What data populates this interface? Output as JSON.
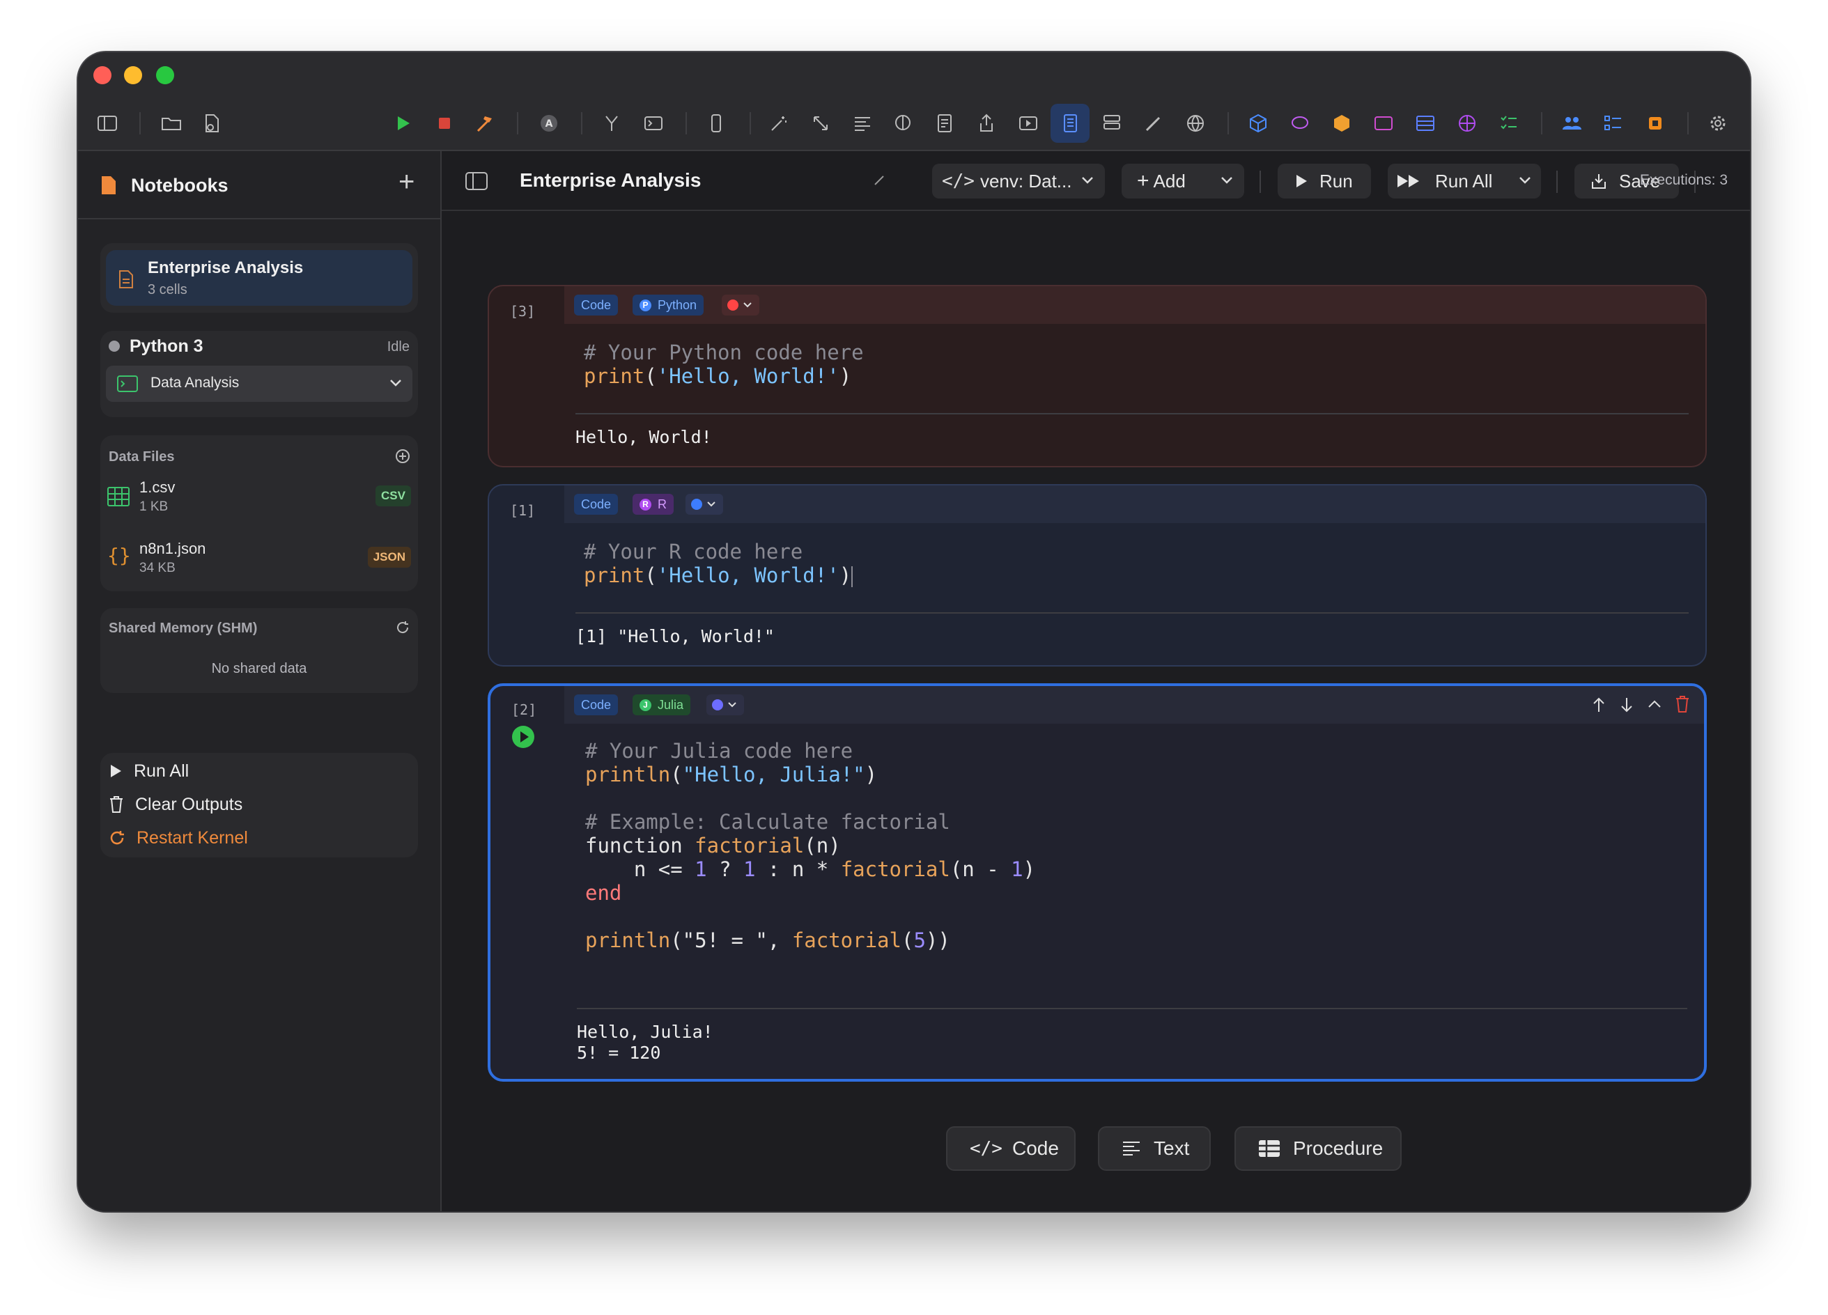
{
  "window": {
    "toolbar": {
      "icons": [
        "sidebar-toggle-icon",
        "folder-icon",
        "document-gear-icon",
        "play-icon",
        "stop-icon",
        "hammer-icon",
        "account-icon",
        "branch-icon",
        "terminal-icon",
        "device-icon",
        "wand-icon",
        "resize-icon",
        "align-icon",
        "brain-icon",
        "notes-icon",
        "share-icon",
        "video-icon",
        "notebook-icon",
        "database-icon",
        "brush-icon",
        "globe-icon",
        "cube-icon",
        "chat-icon",
        "package-icon",
        "window-icon",
        "table-icon",
        "network-icon",
        "checklist-icon",
        "people-icon",
        "list-icon",
        "chip-icon",
        "gear-icon"
      ]
    }
  },
  "sidebar": {
    "title": "Notebooks",
    "add_label": "+",
    "notebook": {
      "name": "Enterprise Analysis",
      "cells": "3 cells"
    },
    "kernel": {
      "name": "Python 3",
      "status": "Idle",
      "env": "Data Analysis"
    },
    "data_files": {
      "title": "Data Files",
      "files": [
        {
          "name": "1.csv",
          "size": "1 KB",
          "badge": "CSV"
        },
        {
          "name": "n8n1.json",
          "size": "34 KB",
          "badge": "JSON"
        }
      ]
    },
    "shm": {
      "title": "Shared Memory (SHM)",
      "empty": "No shared data"
    },
    "actions": {
      "run_all": "Run All",
      "clear_outputs": "Clear Outputs",
      "restart_kernel": "Restart Kernel"
    }
  },
  "main": {
    "title": "Enterprise Analysis",
    "venv": "venv: Dat...",
    "add": "Add",
    "run": "Run",
    "run_all": "Run All",
    "save": "Save",
    "executions": "Executions: 3",
    "cells": [
      {
        "counter": "[3]",
        "type": "Code",
        "lang": "Python",
        "code_comment": "# Your Python code here",
        "code_fn": "print",
        "code_args": "'Hello, World!'",
        "output": "Hello, World!"
      },
      {
        "counter": "[1]",
        "type": "Code",
        "lang": "R",
        "code_comment": "# Your R code here",
        "code_fn": "print",
        "code_args": "'Hello, World!'",
        "output": "[1] \"Hello, World!\""
      },
      {
        "counter": "[2]",
        "type": "Code",
        "lang": "Julia",
        "output": "Hello, Julia!\n5! = 120"
      }
    ],
    "julia_code": {
      "l1": "# Your Julia code here",
      "l2_fn": "println",
      "l2_args": "\"Hello, Julia!\"",
      "l4": "# Example: Calculate factorial",
      "l5_kw": "function",
      "l5_fn": "factorial",
      "l5_rest": "(n)",
      "l6_a": "    n <= ",
      "l6_n1": "1",
      "l6_b": " ? ",
      "l6_n2": "1",
      "l6_c": " : n * ",
      "l6_fn": "factorial",
      "l6_d": "(n - ",
      "l6_n3": "1",
      "l6_e": ")",
      "l7": "end",
      "l9_fn": "println",
      "l9_a": "(\"5! = \", ",
      "l9_fn2": "factorial",
      "l9_b": "(",
      "l9_n": "5",
      "l9_c": "))"
    },
    "add_cell": {
      "code": "Code",
      "text": "Text",
      "procedure": "Procedure"
    }
  },
  "colors": {
    "accent": "#2f6fe0",
    "python_cell": "#2a1d1e",
    "r_cell": "#1f2433",
    "julia_cell": "#21222e",
    "orange": "#f08a3c"
  }
}
